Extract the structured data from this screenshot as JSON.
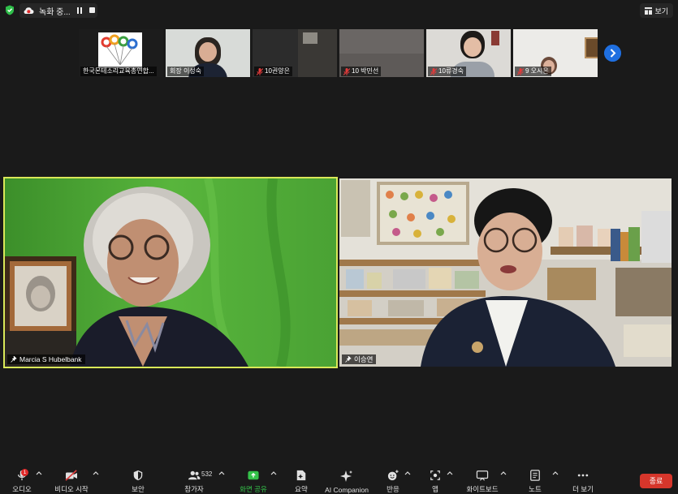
{
  "colors": {
    "background": "#1a1a1a",
    "accent_green": "#35c24a",
    "active_speaker_border": "#d9e858",
    "end_red": "#d6362b",
    "next_blue": "#1f6fe0"
  },
  "topbar": {
    "shield_icon": "shield-check-icon",
    "recording_label": "녹화 중...",
    "view_label": "보기"
  },
  "thumbnails": [
    {
      "name": "한국몬테소리교육총연합...",
      "muted": false
    },
    {
      "name": "회장 이성숙",
      "muted": false
    },
    {
      "name": "10권양은",
      "muted": true
    },
    {
      "name": "10 박민선",
      "muted": true
    },
    {
      "name": "10류경숙",
      "muted": true
    },
    {
      "name": "9 오시은",
      "muted": true
    }
  ],
  "main_videos": [
    {
      "name": "Marcia S Hubelbank",
      "pinned": true
    },
    {
      "name": "이승연",
      "pinned": true
    }
  ],
  "toolbar": {
    "audio": {
      "label": "오디오",
      "badge": "1"
    },
    "video": {
      "label": "비디오 시작"
    },
    "security": {
      "label": "보안"
    },
    "participants": {
      "label": "참가자",
      "count": "532"
    },
    "share": {
      "label": "화면 공유"
    },
    "summary": {
      "label": "요약"
    },
    "ai": {
      "label": "AI Companion"
    },
    "reactions": {
      "label": "반응"
    },
    "apps": {
      "label": "앱"
    },
    "whiteboard": {
      "label": "화이트보드"
    },
    "notes": {
      "label": "노트"
    },
    "more": {
      "label": "더 보기"
    },
    "end": {
      "label": "종료"
    }
  }
}
